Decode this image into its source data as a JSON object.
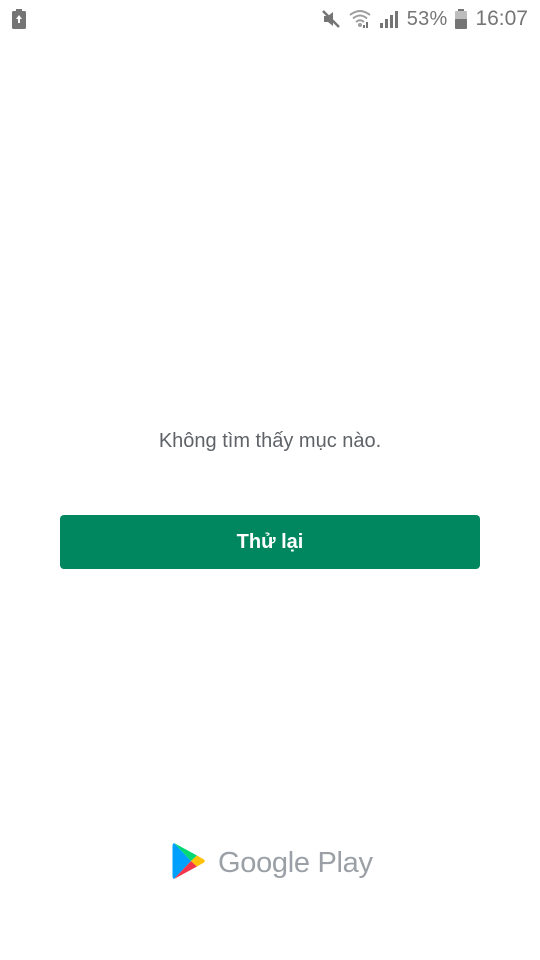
{
  "status_bar": {
    "battery_percent": "53%",
    "time": "16:07",
    "icons": [
      "battery-saver-icon",
      "mute-icon",
      "wifi-icon",
      "signal-icon",
      "battery-icon"
    ]
  },
  "main": {
    "message": "Không tìm thấy mục nào.",
    "retry_label": "Thử lại"
  },
  "footer": {
    "logo_text": "Google Play"
  },
  "colors": {
    "accent": "#01875f",
    "text_secondary": "#5f6368",
    "status_icons": "#757575"
  }
}
